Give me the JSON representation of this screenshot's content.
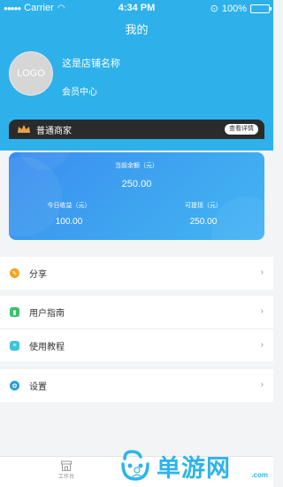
{
  "status_bar": {
    "carrier": "Carrier",
    "time": "4:34 PM",
    "battery": "100%"
  },
  "header": {
    "title": "我的",
    "logo_text": "LOGO",
    "store_name": "这是店铺名称",
    "member_center": "会员中心"
  },
  "merchant": {
    "label": "普通商家",
    "detail_button": "查看详情"
  },
  "balance": {
    "current_label": "当前余额（元）",
    "current_value": "250.00",
    "today_label": "今日收益（元）",
    "today_value": "100.00",
    "withdrawable_label": "可提现（元）",
    "withdrawable_value": "250.00"
  },
  "menu": {
    "share": "分享",
    "guide": "用户指南",
    "tutorial": "使用教程",
    "settings": "设置"
  },
  "tabs": {
    "work": "工作台"
  },
  "watermark": {
    "text": "单游网",
    "url": ".com"
  },
  "colors": {
    "header": "#2eb1ea",
    "merchant_bar": "#2b2b2b",
    "card_blue": "#3b8df0",
    "share": "#f0a623",
    "guide": "#3dbf6a",
    "tutorial": "#3fc1d9",
    "settings": "#2aa0d6"
  }
}
